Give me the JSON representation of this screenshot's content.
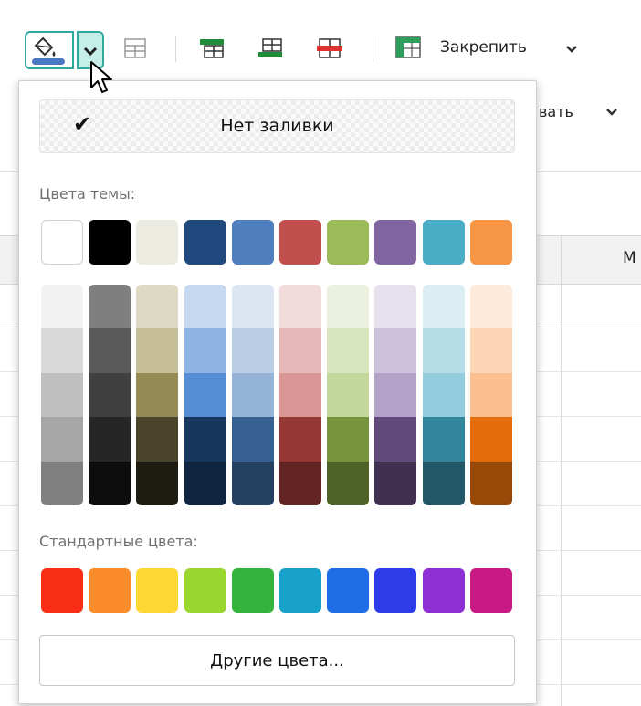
{
  "toolbar": {
    "freeze_label": "Закрепить",
    "row2_partial_label": "вать",
    "colors": {
      "accent": "#2fa89e",
      "accent_light": "#c6eee8",
      "fill_bar": "#4a78c3"
    }
  },
  "sheet": {
    "column_letter_partial": "М"
  },
  "panel": {
    "no_fill_label": "Нет заливки",
    "theme_label": "Цвета темы:",
    "standard_label": "Стандартные цвета:",
    "other_label": "Другие цвета...",
    "theme_colors": [
      "#ffffff",
      "#000000",
      "#ecebe1",
      "#1f487c",
      "#4f7fbe",
      "#c0504d",
      "#9bba58",
      "#8165a3",
      "#4aadc6",
      "#f79646"
    ],
    "theme_shades": [
      [
        "#f2f2f2",
        "#d9d9d9",
        "#bfbfbf",
        "#a6a6a6",
        "#808080"
      ],
      [
        "#7f7f7f",
        "#595959",
        "#404040",
        "#262626",
        "#0d0d0d"
      ],
      [
        "#ddd9c4",
        "#c5be97",
        "#948a54",
        "#4a452a",
        "#1e1c11"
      ],
      [
        "#c6d9f1",
        "#8eb4e3",
        "#558ed5",
        "#17375e",
        "#10253f"
      ],
      [
        "#dce6f2",
        "#b9cde5",
        "#95b3d7",
        "#376092",
        "#254061"
      ],
      [
        "#f2dcdb",
        "#e6b9b8",
        "#d99694",
        "#953735",
        "#632523"
      ],
      [
        "#ebf1de",
        "#d7e4bd",
        "#c3d69b",
        "#77933c",
        "#4f6228"
      ],
      [
        "#e6e0ec",
        "#ccc1da",
        "#b3a2c7",
        "#604a7b",
        "#403152"
      ],
      [
        "#dbeef4",
        "#b7dee8",
        "#93cddd",
        "#31859c",
        "#215968"
      ],
      [
        "#fdeada",
        "#fcd5b5",
        "#fac090",
        "#e46c0a",
        "#984807"
      ]
    ],
    "standard_colors": [
      "#fa2d16",
      "#fb8c2b",
      "#fdd835",
      "#9ad72e",
      "#34b43c",
      "#19a2c9",
      "#1f6ee8",
      "#2d3ce8",
      "#8e2fd3",
      "#c71a84"
    ]
  }
}
